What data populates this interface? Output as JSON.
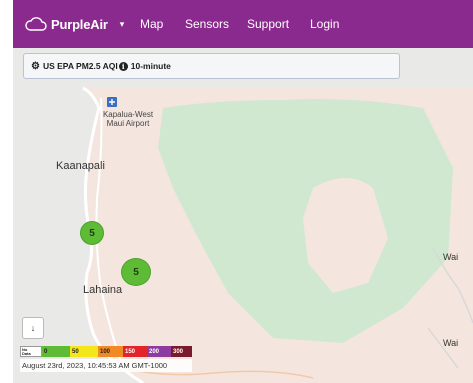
{
  "nav": {
    "brand": "PurpleAir",
    "caret": "▾",
    "links": [
      "Map",
      "Sensors",
      "Support",
      "Login"
    ]
  },
  "settings": {
    "label": "US EPA PM2.5 AQI",
    "info": "i",
    "period": "10-minute"
  },
  "map": {
    "airport_label": "Kapalua-West\nMaui Airport",
    "towns": [
      "Kaanapali",
      "Lahaina"
    ],
    "edge_labels": [
      "Wai",
      "Wai"
    ],
    "markers": [
      {
        "value": "5",
        "color": "#5dbb36"
      },
      {
        "value": "5",
        "color": "#5dbb36"
      }
    ]
  },
  "download_icon": "↓",
  "legend": {
    "nodata_label": "No Data",
    "stops": [
      {
        "label": "0",
        "color": "#5dbb36"
      },
      {
        "label": "50",
        "color": "#f5e61c"
      },
      {
        "label": "100",
        "color": "#f08a24"
      },
      {
        "label": "150",
        "color": "#e3242b"
      },
      {
        "label": "200",
        "color": "#8e3ba0"
      },
      {
        "label": "300",
        "color": "#7a1a2c"
      }
    ]
  },
  "timestamp": "August 23rd, 2023, 10:45:53 AM GMT-1000",
  "colors": {
    "navbar": "#8b2a8e",
    "land": "#f4e6de",
    "park": "#cfe8cf",
    "marker": "#5dbb36"
  }
}
